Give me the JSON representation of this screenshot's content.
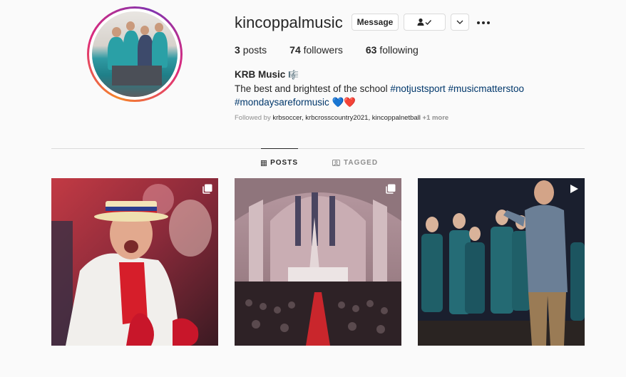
{
  "profile": {
    "username": "kincoppalmusic",
    "message_label": "Message",
    "stats": {
      "posts_count": "3",
      "posts_label": "posts",
      "followers_count": "74",
      "followers_label": "followers",
      "following_count": "63",
      "following_label": "following"
    },
    "display_name": "KRB Music",
    "name_emoji": "🎼",
    "bio_text": "The best and brightest of the school",
    "hashtags": [
      "#notjustsport",
      "#musicmatterstoo",
      "#mondaysareformusic"
    ],
    "bio_emoji": "💙❤️",
    "followed_by_prefix": "Followed by",
    "followed_by": "krbsoccer, krbcrosscountry2021, kincoppalnetball",
    "followed_more": "+1 more"
  },
  "tabs": [
    {
      "label": "POSTS",
      "icon": "grid-icon",
      "active": true
    },
    {
      "label": "TAGGED",
      "icon": "tagged-icon",
      "active": false
    }
  ],
  "posts": [
    {
      "type": "carousel",
      "icon": "carousel-icon"
    },
    {
      "type": "carousel",
      "icon": "carousel-icon"
    },
    {
      "type": "video",
      "icon": "video-icon"
    }
  ],
  "colors": {
    "text": "#262626",
    "secondary": "#8e8e8e",
    "link": "#00376b",
    "border": "#dbdbdb",
    "background": "#fafafa"
  }
}
